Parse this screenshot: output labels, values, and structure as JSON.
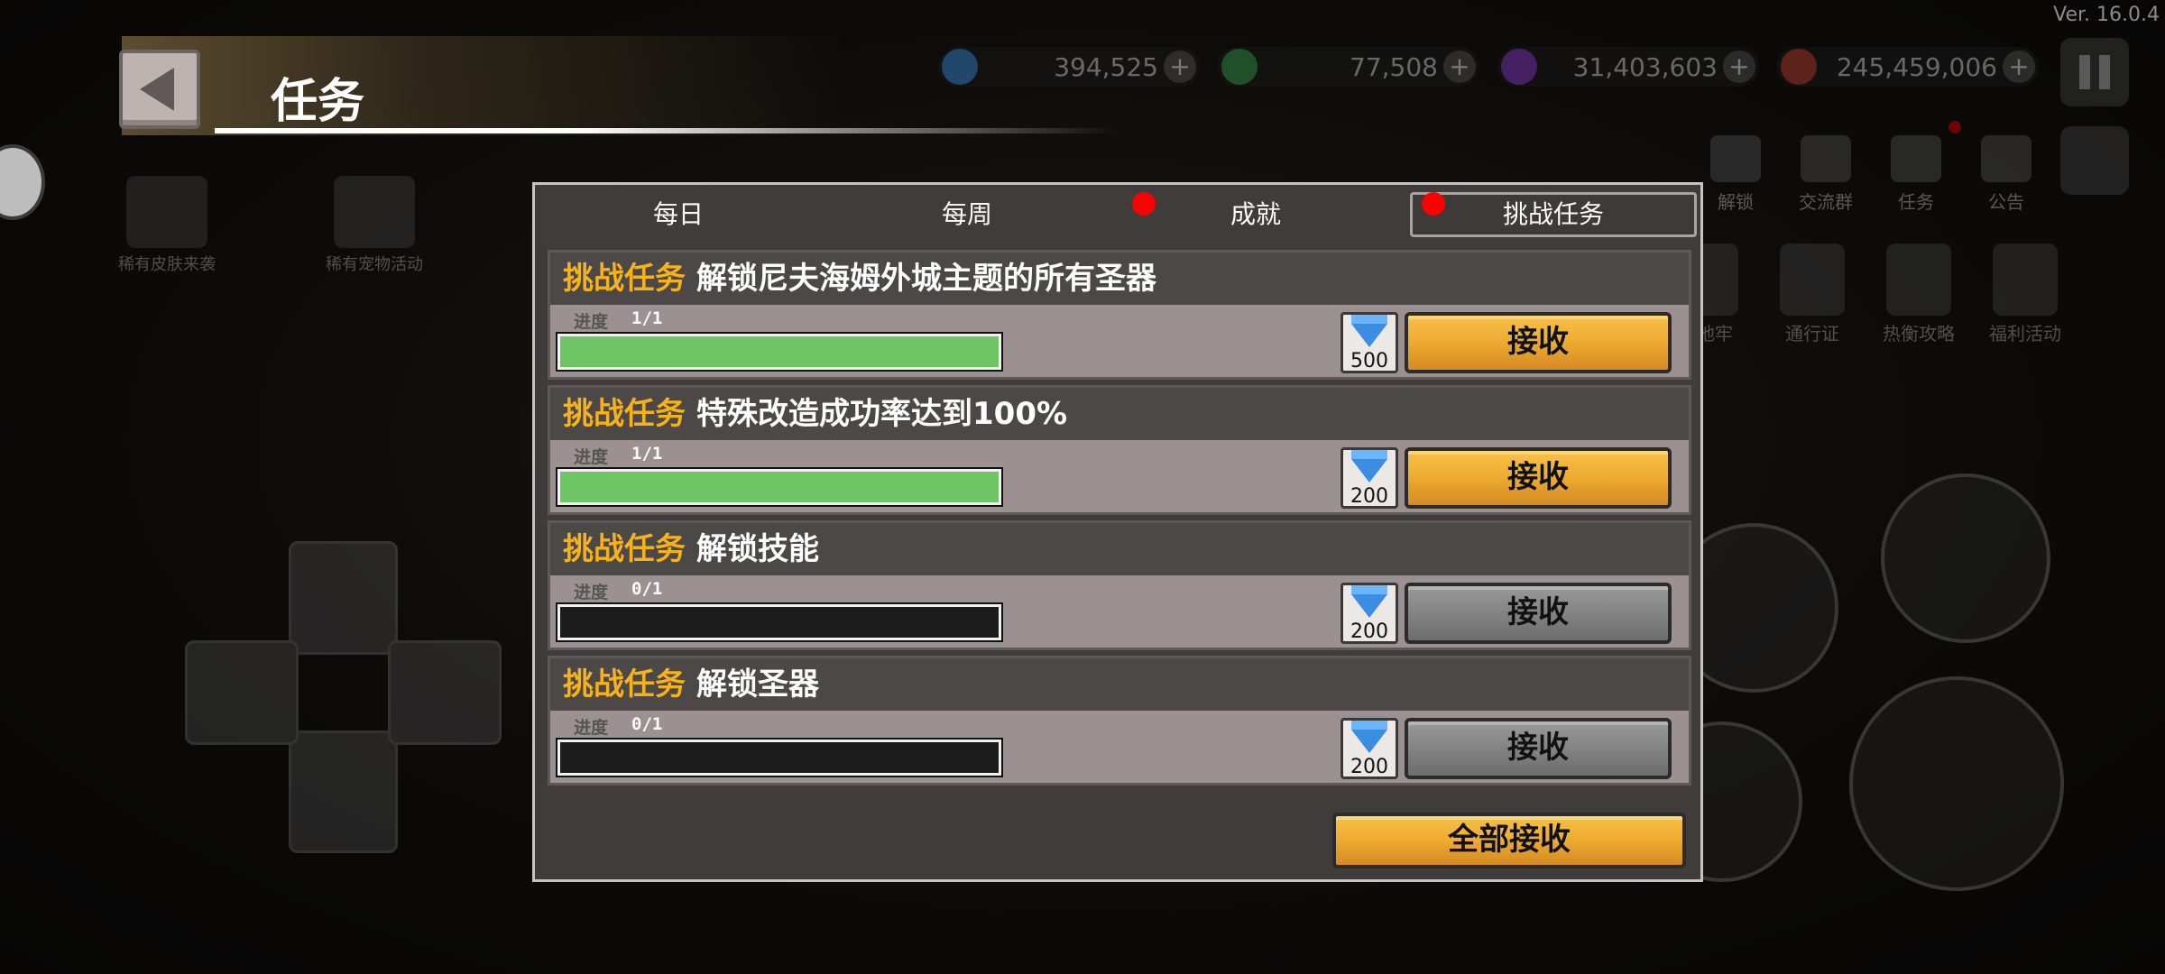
{
  "version": "Ver. 16.0.4",
  "header": {
    "title": "任务"
  },
  "currencies": [
    {
      "icon": "diamond-icon",
      "value": "394,525",
      "color": "#3a8de0"
    },
    {
      "icon": "green-coin-icon",
      "value": "77,508",
      "color": "#3aa04a"
    },
    {
      "icon": "purple-crystal-icon",
      "value": "31,403,603",
      "color": "#8a3ad0"
    },
    {
      "icon": "helmet-icon",
      "value": "245,459,006",
      "color": "#c04030"
    }
  ],
  "top_menu": [
    "解锁",
    "交流群",
    "任务",
    "公告"
  ],
  "event_menu": [
    "入地牢",
    "通行证",
    "热衡攻略",
    "福利活动"
  ],
  "left_events": [
    "稀有皮肤来袭",
    "稀有宠物活动"
  ],
  "tabs": [
    {
      "label": "每日",
      "active": false,
      "badge": false
    },
    {
      "label": "每周",
      "active": false,
      "badge": false
    },
    {
      "label": "成就",
      "active": false,
      "badge": true
    },
    {
      "label": "挑战任务",
      "active": true,
      "badge": true
    }
  ],
  "progress_label": "进度",
  "quests": [
    {
      "tag": "挑战任务",
      "name": "解锁尼夫海姆外城主题的所有圣器",
      "progress": "1/1",
      "ratio": 1,
      "reward": "500",
      "claim_label": "接收",
      "claimable": true
    },
    {
      "tag": "挑战任务",
      "name": "特殊改造成功率达到100%",
      "progress": "1/1",
      "ratio": 1,
      "reward": "200",
      "claim_label": "接收",
      "claimable": true
    },
    {
      "tag": "挑战任务",
      "name": "解锁技能",
      "progress": "0/1",
      "ratio": 0,
      "reward": "200",
      "claim_label": "接收",
      "claimable": false
    },
    {
      "tag": "挑战任务",
      "name": "解锁圣器",
      "progress": "0/1",
      "ratio": 0,
      "reward": "200",
      "claim_label": "接收",
      "claimable": false
    }
  ],
  "claim_all_label": "全部接收",
  "colors": {
    "accent_tag": "#f6b21b",
    "progress_fill": "#6fc466",
    "claim_active": "#f0ad33",
    "claim_inactive": "#838383",
    "badge": "#ff0000"
  }
}
